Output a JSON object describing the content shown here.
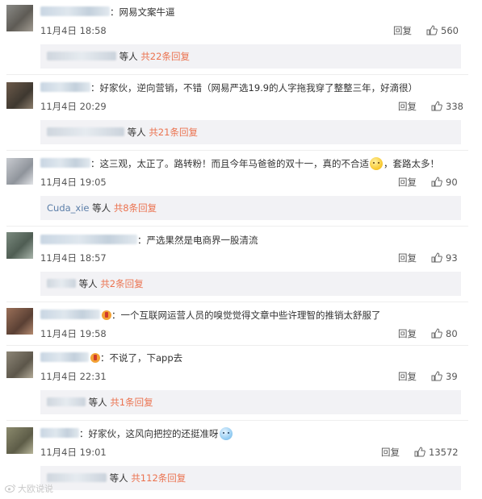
{
  "comments": [
    {
      "text": "：网易文案牛逼",
      "time": "11月4日 18:58",
      "reply": "回复",
      "likes": "560",
      "replies": {
        "suffix": "等人",
        "count": "共22条回复"
      }
    },
    {
      "text": "：好家伙，逆向营销，不错（网易严选19.9的人字拖我穿了整整三年，好滴很）",
      "time": "11月4日 20:29",
      "reply": "回复",
      "likes": "338",
      "replies": {
        "suffix": "等人",
        "count": "共21条回复"
      }
    },
    {
      "text_a": "：这三观，太正了。路转粉！而且今年马爸爸的双十一，真的不合适",
      "text_b": "，套路太多！",
      "time": "11月4日 19:05",
      "reply": "回复",
      "likes": "90",
      "replies": {
        "name": "Cuda_xie",
        "suffix": "等人",
        "count": "共8条回复"
      }
    },
    {
      "text": "：严选果然是电商界一股清流",
      "time": "11月4日 18:57",
      "reply": "回复",
      "likes": "93",
      "replies": {
        "suffix": "等人",
        "count": "共2条回复"
      }
    },
    {
      "text": "：一个互联网运营人员的嗅觉觉得文章中些许理智的推销太舒服了",
      "time": "11月4日 19:58",
      "reply": "回复",
      "likes": "80"
    },
    {
      "text": "：不说了，下app去",
      "time": "11月4日 22:31",
      "reply": "回复",
      "likes": "39",
      "replies": {
        "suffix": "等人",
        "count": "共1条回复"
      }
    },
    {
      "text": "：好家伙，这风向把控的还挺准呀",
      "time": "11月4日 19:01",
      "reply": "回复",
      "likes": "13572",
      "replies": {
        "suffix": "等人",
        "count": "共112条回复"
      }
    }
  ],
  "watermark": "大欧说说",
  "icons": {
    "like": "thumbs-up-icon",
    "badge": "vip-badge-icon",
    "emoji": "smile-emoji-icon",
    "logo": "weibo-logo-icon"
  },
  "colors": {
    "accent": "#eb7350",
    "name_link": "#5b7ea8",
    "reply_box": "#f2f2f5"
  }
}
